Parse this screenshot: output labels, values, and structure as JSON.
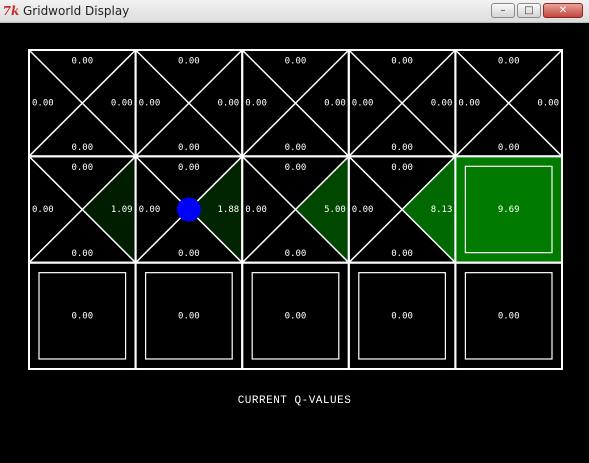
{
  "window": {
    "title": "Gridworld Display",
    "icon": "tk-feather-icon"
  },
  "caption": "CURRENT Q-VALUES",
  "colors": {
    "positive_green": "#008800",
    "agent": "#0000ff",
    "grid_line": "#ffffff",
    "background": "#000000"
  },
  "agent": {
    "row": 1,
    "col": 1
  },
  "grid": {
    "rows": 3,
    "cols": 5,
    "cells": [
      [
        {
          "type": "q",
          "north": "0.00",
          "west": "0.00",
          "east": "0.00",
          "south": "0.00"
        },
        {
          "type": "q",
          "north": "0.00",
          "west": "0.00",
          "east": "0.00",
          "south": "0.00"
        },
        {
          "type": "q",
          "north": "0.00",
          "west": "0.00",
          "east": "0.00",
          "south": "0.00"
        },
        {
          "type": "q",
          "north": "0.00",
          "west": "0.00",
          "east": "0.00",
          "south": "0.00"
        },
        {
          "type": "q",
          "north": "0.00",
          "west": "0.00",
          "east": "0.00",
          "south": "0.00"
        }
      ],
      [
        {
          "type": "q",
          "north": "0.00",
          "west": "0.00",
          "east": "1.09",
          "south": "0.00"
        },
        {
          "type": "q",
          "north": "0.00",
          "west": "0.00",
          "east": "1.88",
          "south": "0.00"
        },
        {
          "type": "q",
          "north": "0.00",
          "west": "0.00",
          "east": "5.00",
          "south": "0.00"
        },
        {
          "type": "q",
          "north": "0.00",
          "west": "0.00",
          "east": "8.13",
          "south": "0.00"
        },
        {
          "type": "terminal",
          "value": "9.69"
        }
      ],
      [
        {
          "type": "terminal",
          "value": "0.00"
        },
        {
          "type": "terminal",
          "value": "0.00"
        },
        {
          "type": "terminal",
          "value": "0.00"
        },
        {
          "type": "terminal",
          "value": "0.00"
        },
        {
          "type": "terminal",
          "value": "0.00"
        }
      ]
    ]
  }
}
